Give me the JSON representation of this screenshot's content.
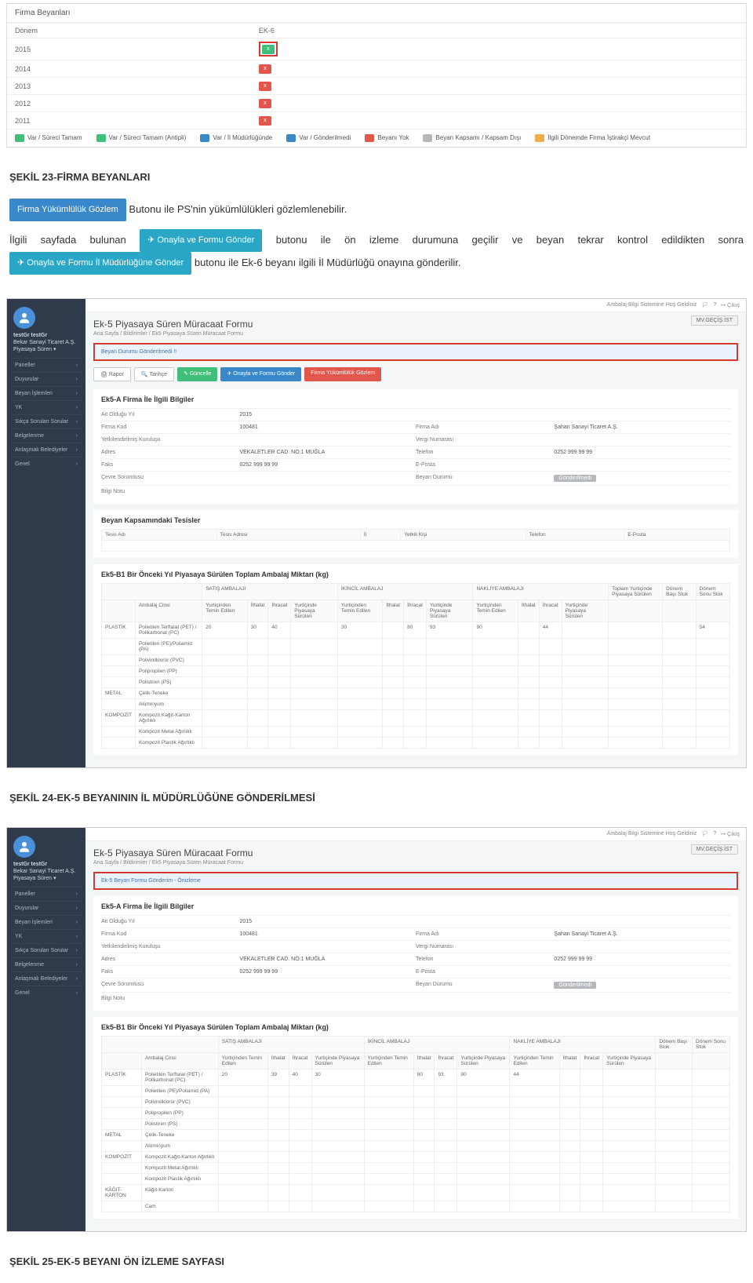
{
  "firma_panel": {
    "title": "Firma Beyanları",
    "col_donem": "Dönem",
    "col_ek6": "EK-6",
    "years": [
      {
        "year": "2015",
        "pill": "pill-green",
        "highlight": true
      },
      {
        "year": "2014",
        "pill": "pill-red",
        "highlight": false
      },
      {
        "year": "2013",
        "pill": "pill-red",
        "highlight": false
      },
      {
        "year": "2012",
        "pill": "pill-red",
        "highlight": false
      },
      {
        "year": "2011",
        "pill": "pill-red",
        "highlight": false
      }
    ],
    "legend": [
      {
        "color": "#3fbf79",
        "label": "Var / Süreci Tamam"
      },
      {
        "color": "#3fbf79",
        "label": "Var / Süreci Tamam (Antipli)"
      },
      {
        "color": "#3a87c9",
        "label": "Var / İl Müdürlüğünde"
      },
      {
        "color": "#3a87c9",
        "label": "Var / Gönderilmedi"
      },
      {
        "color": "#e2574c",
        "label": "Beyanı Yok"
      },
      {
        "color": "#b5b9bd",
        "label": "Beyan Kapsamı / Kapsam Dışı"
      },
      {
        "color": "#f0ad4e",
        "label": "İlgili Dönemde Firma İştirakçi Mevcut"
      }
    ]
  },
  "cap23": "ŞEKİL 23-FİRMA BEYANLARI",
  "para1": {
    "btn1": "Firma Yükümlülük Gözlem",
    "t1": " Butonu ile PS'nin yükümlülükleri gözlemlenebilir.",
    "t2a": "İlgili sayfada bulunan ",
    "btn2": "✈ Onayla ve Formu Gönder",
    "t2b": " butonu ile ön izleme durumuna geçilir ve beyan tekrar kontrol edildikten sonra ",
    "btn3": "✈ Onayla ve Formu İl Müdürlüğüne Gönder",
    "t2c": " butonu ile Ek-6 beyanı ilgili İl Müdürlüğü onayına gönderilir."
  },
  "ss24": {
    "topbar_welcome": "Ambalaj Bilgi Sistemine Hoş Geldiniz",
    "topbar_exit": "Çıkış",
    "user_name": "testGr testGr",
    "user_sub": "Bekar Sanayi Ticaret A.Ş.\nPiyasaya Süren ▾",
    "side_items": [
      "Paneller",
      "Duyurular",
      "Beyan İşlemleri",
      "YK",
      "Sıkça Sorulan Sorular",
      "Belgelenme",
      "Anlaşmalı Belediyeler",
      "Genel"
    ],
    "title": "Ek-5 Piyasaya Süren Müracaat Formu",
    "crumb": "Ana Sayfa / Bildirimler / Ek5 Piyasaya Süren Müracaat Formu",
    "mv_btn": "MV.GEÇİŞ.İST",
    "alert": "Beyan Durumu Gönderilmedi !!",
    "toolbar": [
      {
        "cls": "grey",
        "label": "🖨 Rapor"
      },
      {
        "cls": "grey",
        "label": "🔍 Tarihçe"
      },
      {
        "cls": "green",
        "label": "✎ Güncelle"
      },
      {
        "cls": "blue",
        "label": "✈ Onayla ve Formu Gönder"
      },
      {
        "cls": "red",
        "label": "Firma Yükümlülük Gözlem"
      }
    ],
    "sectionA_title": "Ek5-A Firma İle İlgili Bilgiler",
    "sectionA": [
      {
        "k1": "Ait Olduğu Yıl",
        "v1": "2015",
        "k2": "",
        "v2": ""
      },
      {
        "k1": "Firma Kod",
        "v1": "100481",
        "k2": "Firma Adı",
        "v2": "Şahan Sanayi Ticaret A.Ş."
      },
      {
        "k1": "Yetkilendirilmiş Kuruluşu",
        "v1": "",
        "k2": "Vergi Numarası",
        "v2": ""
      },
      {
        "k1": "Adres",
        "v1": "VEKALETLER CAD. NO:1 MUĞLA",
        "k2": "Telefon",
        "v2": "0252 999 99 99"
      },
      {
        "k1": "Faks",
        "v1": "0252 999 99 99",
        "k2": "E-Posta",
        "v2": ""
      },
      {
        "k1": "Çevre Sorumlusu",
        "v1": "",
        "k2": "Beyan Durumu",
        "v2": "Gönderilmedi"
      },
      {
        "k1": "Bilgi Notu",
        "v1": "",
        "k2": "",
        "v2": ""
      }
    ],
    "tesis_title": "Beyan Kapsamındaki Tesisler",
    "tesis_headers": [
      "Tesis Adı",
      "Tesis Adresi",
      "İl",
      "Yetkili Kişi",
      "Telefon",
      "E-Posta"
    ],
    "b1_title": "Ek5-B1 Bir Önceki Yıl Piyasaya Sürülen Toplam Ambalaj Miktarı (kg)",
    "b1_group_headers": [
      "SATIŞ AMBALAJI",
      "İKİNCİL AMBALAJ",
      "NAKLİYE AMBALAJI",
      "Toplam Yurtiçinde Piyasaya Sürülen",
      "Dönem Başı Stok",
      "Dönem Sonu Stok"
    ],
    "b1_sub_headers": [
      "Ambalaj Cinsi",
      "Yurtiçinden Temin Edilen",
      "İthalat",
      "İhracat",
      "Yurtiçinde Piyasaya Sürülen",
      "Yurtiçinden Temin Edilen",
      "İthalat",
      "İhracat",
      "Yurtiçinde Piyasaya Sürülen",
      "Yurtiçinden Temin Edilen",
      "İthalat",
      "İhracat",
      "Yurtiçinde Piyasaya Sürülen"
    ],
    "b1_rows": [
      {
        "grp": "PLASTİK",
        "name": "Polietilen Terftalat (PET) / Polikarbonat (PC)",
        "vals": [
          "20",
          "30",
          "40",
          "",
          "30",
          "",
          "80",
          "93",
          "90",
          "",
          "44",
          "",
          "",
          "",
          "54"
        ]
      },
      {
        "grp": "",
        "name": "Polietilen (PE)/Poliamid (PA)",
        "vals": []
      },
      {
        "grp": "",
        "name": "Polivinilklorür (PVC)",
        "vals": []
      },
      {
        "grp": "",
        "name": "Polipropilen (PP)",
        "vals": []
      },
      {
        "grp": "",
        "name": "Polistiren (PS)",
        "vals": []
      },
      {
        "grp": "METAL",
        "name": "Çelik-Teneke",
        "vals": []
      },
      {
        "grp": "",
        "name": "Alüminyum",
        "vals": []
      },
      {
        "grp": "KOMPOZİT",
        "name": "Kompozit Kağıt-Karton Ağırlıklı",
        "vals": []
      },
      {
        "grp": "",
        "name": "Kompozit Metal Ağırlıklı",
        "vals": []
      },
      {
        "grp": "",
        "name": "Kompozit Plastik Ağırlıklı",
        "vals": []
      }
    ]
  },
  "cap24": "ŞEKİL 24-EK-5 BEYANININ İL MÜDÜRLÜĞÜNE GÖNDERİLMESİ",
  "ss25": {
    "alert": "Ek-5 Beyan Formu Gönderim - Önizleme",
    "b1_group_headers": [
      "SATIŞ AMBALAJI",
      "İKİNCİL AMBALAJ",
      "NAKLİYE AMBALAJI",
      "Dönem Başı Stok",
      "Dönem Sonu Stok"
    ],
    "b1_sub_headers": [
      "Ambalaj Cinsi",
      "Yurtiçinden Temin Edilen",
      "İthalat",
      "İhracat",
      "Yurtiçinde Piyasaya Sürülen",
      "Yurtiçinden Temin Edilen",
      "İthalat",
      "İhracat",
      "Yurtiçinde Piyasaya Sürülen",
      "Yurtiçinden Temin Edilen",
      "İthalat",
      "İhracat",
      "Yurtiçinde Piyasaya Sürülen"
    ],
    "b1_rows": [
      {
        "grp": "PLASTİK",
        "name": "Polietilen Terftalat (PET) / Polikarbonat (PC)",
        "vals": [
          "20",
          "39",
          "40",
          "30",
          "",
          "80",
          "93",
          "90",
          "44",
          "",
          "",
          ""
        ]
      },
      {
        "grp": "",
        "name": "Polietilen (PE)/Poliamid (PA)",
        "vals": []
      },
      {
        "grp": "",
        "name": "Polivinilklorür (PVC)",
        "vals": []
      },
      {
        "grp": "",
        "name": "Polipropilen (PP)",
        "vals": []
      },
      {
        "grp": "",
        "name": "Polistiren (PS)",
        "vals": []
      },
      {
        "grp": "METAL",
        "name": "Çelik-Teneke",
        "vals": []
      },
      {
        "grp": "",
        "name": "Alüminyum",
        "vals": []
      },
      {
        "grp": "KOMPOZİT",
        "name": "Kompozit Kağıt-Karton Ağırlıklı",
        "vals": []
      },
      {
        "grp": "",
        "name": "Kompozit Metal Ağırlıklı",
        "vals": []
      },
      {
        "grp": "",
        "name": "Kompozit Plastik Ağırlıklı",
        "vals": []
      },
      {
        "grp": "KÂĞIT-KARTON",
        "name": "Kâğıt-Karton",
        "vals": []
      },
      {
        "grp": "",
        "name": "Cam",
        "vals": []
      }
    ]
  },
  "cap25": "ŞEKİL 25-EK-5 BEYANI ÖN İZLEME SAYFASI"
}
